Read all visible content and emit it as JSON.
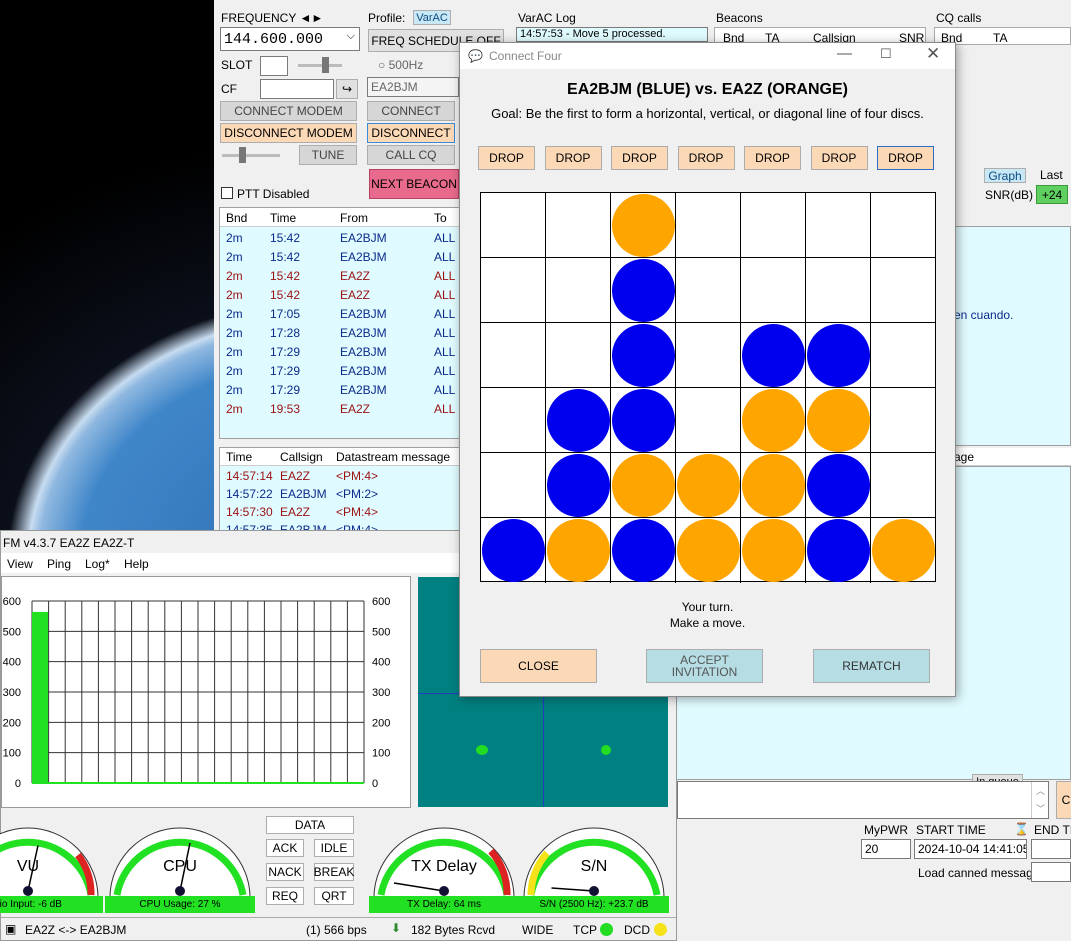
{
  "varac": {
    "frequency_label": "FREQUENCY ◄►",
    "frequency_value": "144.600.000",
    "profile_label": "Profile:",
    "profile_value": "VarAC",
    "freq_schedule": "FREQ SCHEDULE OFF",
    "slot_label": "SLOT",
    "bw_500": "500Hz",
    "cf_label": "CF",
    "callsign_input": "EA2BJM",
    "connect_modem": "CONNECT MODEM",
    "disconnect_modem": "DISCONNECT MODEM",
    "tune": "TUNE",
    "connect": "CONNECT",
    "disconnect": "DISCONNECT",
    "call_cq": "CALL CQ",
    "next_beacon": "NEXT BEACON",
    "ptt_disabled": "PTT Disabled",
    "log_title": "VarAC Log",
    "log_line": "14:57:53 - Move 5 processed.",
    "beacons_title": "Beacons",
    "beacons_cols": [
      "Bnd",
      "TA",
      "Callsign",
      "SNR"
    ],
    "cq_title": "CQ calls",
    "cq_cols": [
      "Bnd",
      "TA"
    ],
    "graph_btn": "Graph",
    "last_label": "Last",
    "snr_label": "SNR(dB)",
    "snr_value": "+24",
    "chat_fragment": "en cuando.",
    "msg_header_fragment": "age",
    "in_queue": "In queue",
    "mypwr_label": "MyPWR",
    "mypwr_value": "20",
    "start_time_label": "START TIME",
    "start_time_value": "2024-10-04 14:41:05",
    "end_time_label": "END TI",
    "canned_label": "Load canned message:",
    "list_cols": [
      "Bnd",
      "Time",
      "From",
      "To"
    ],
    "list_rows": [
      {
        "bnd": "2m",
        "time": "15:42",
        "from": "EA2BJM",
        "to": "ALL",
        "color": "blue"
      },
      {
        "bnd": "2m",
        "time": "15:42",
        "from": "EA2BJM",
        "to": "ALL",
        "color": "blue"
      },
      {
        "bnd": "2m",
        "time": "15:42",
        "from": "EA2Z",
        "to": "ALL",
        "color": "red"
      },
      {
        "bnd": "2m",
        "time": "15:42",
        "from": "EA2Z",
        "to": "ALL",
        "color": "red"
      },
      {
        "bnd": "2m",
        "time": "17:05",
        "from": "EA2BJM",
        "to": "ALL",
        "color": "blue"
      },
      {
        "bnd": "2m",
        "time": "17:28",
        "from": "EA2BJM",
        "to": "ALL",
        "color": "blue"
      },
      {
        "bnd": "2m",
        "time": "17:29",
        "from": "EA2BJM",
        "to": "ALL",
        "color": "blue"
      },
      {
        "bnd": "2m",
        "time": "17:29",
        "from": "EA2BJM",
        "to": "ALL",
        "color": "blue"
      },
      {
        "bnd": "2m",
        "time": "17:29",
        "from": "EA2BJM",
        "to": "ALL",
        "color": "blue"
      },
      {
        "bnd": "2m",
        "time": "19:53",
        "from": "EA2Z",
        "to": "ALL",
        "color": "red"
      }
    ],
    "ds_cols": [
      "Time",
      "Callsign",
      "Datastream message"
    ],
    "ds_rows": [
      {
        "time": "14:57:14",
        "call": "EA2Z",
        "msg": "<PM:4>",
        "color": "red"
      },
      {
        "time": "14:57:22",
        "call": "EA2BJM",
        "msg": "<PM:2>",
        "color": "blue"
      },
      {
        "time": "14:57:30",
        "call": "EA2Z",
        "msg": "<PM:4>",
        "color": "red"
      },
      {
        "time": "14:57:35",
        "call": "EA2BJM",
        "msg": "<PM:4>",
        "color": "blue"
      }
    ]
  },
  "vara": {
    "title": "FM v4.3.7    EA2Z  EA2Z-T",
    "menu": [
      "View",
      "Ping",
      "Log*",
      "Help"
    ],
    "y_ticks": [
      "600",
      "500",
      "400",
      "300",
      "200",
      "100",
      "0"
    ],
    "y_ticks_right": [
      "600",
      "500",
      "400",
      "300",
      "200",
      "100",
      "0"
    ],
    "bar_fraction": 0.94,
    "gauges": [
      {
        "label": "VU",
        "sub": "dio Input: -6 dB"
      },
      {
        "label": "CPU",
        "sub": "CPU Usage: 27 %"
      },
      {
        "label": "TX Delay",
        "sub": "TX Delay: 64 ms"
      },
      {
        "label": "S/N",
        "sub": "S/N (2500 Hz): +23.7 dB"
      }
    ],
    "buttons": {
      "data": "DATA",
      "ack": "ACK",
      "idle": "IDLE",
      "nack": "NACK",
      "break": "BREAK",
      "req": "REQ",
      "qrt": "QRT"
    },
    "status": {
      "link": "EA2Z <-> EA2BJM",
      "bps": "(1)  566 bps",
      "rcvd": "182 Bytes Rcvd",
      "wide": "WIDE",
      "tcp": "TCP",
      "dcd": "DCD"
    }
  },
  "dialog": {
    "title": "Connect Four",
    "heading": "EA2BJM (BLUE) vs. EA2Z (ORANGE)",
    "goal": "Goal: Be the first to form a horizontal, vertical, or diagonal line of four discs.",
    "drop_label": "DROP",
    "status_line1": "Your turn.",
    "status_line2": "Make a move.",
    "close": "CLOSE",
    "accept_l1": "ACCEPT",
    "accept_l2": "INVITATION",
    "rematch": "REMATCH",
    "colors": {
      "blue": "#0000ee",
      "orange": "#ffa500"
    },
    "board": [
      [
        "",
        "",
        "O",
        "",
        "",
        "",
        ""
      ],
      [
        "",
        "",
        "B",
        "",
        "",
        "",
        ""
      ],
      [
        "",
        "",
        "B",
        "",
        "B",
        "B",
        ""
      ],
      [
        "",
        "B",
        "B",
        "",
        "O",
        "O",
        ""
      ],
      [
        "",
        "B",
        "O",
        "O",
        "O",
        "B",
        ""
      ],
      [
        "B",
        "O",
        "B",
        "O",
        "O",
        "B",
        "O"
      ]
    ]
  }
}
